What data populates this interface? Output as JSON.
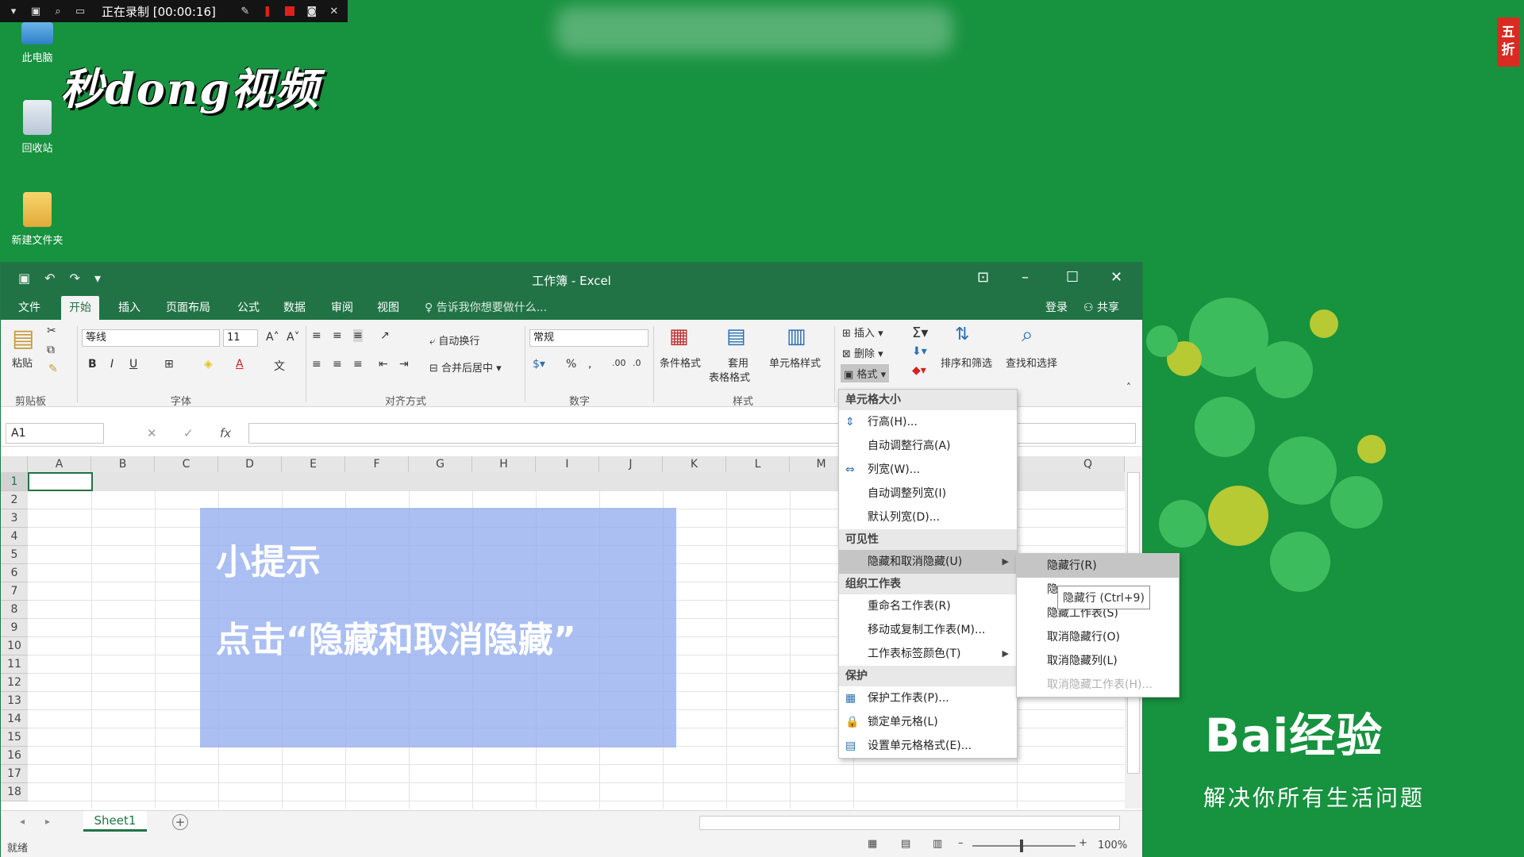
{
  "recorder": {
    "text": "正在录制 [00:00:16]"
  },
  "desktop": {
    "icons": [
      {
        "label": "此电脑"
      },
      {
        "label": "回收站"
      },
      {
        "label": "新建文件夹"
      }
    ],
    "logo": "秒dong视频",
    "promo": "五折"
  },
  "baidu": {
    "logo": "Bai经验",
    "slogan": "解决你所有生活问题"
  },
  "excel": {
    "title": "工作簿 - Excel",
    "tabs": [
      "文件",
      "开始",
      "插入",
      "页面布局",
      "公式",
      "数据",
      "审阅",
      "视图"
    ],
    "tell_me": "告诉我你想要做什么...",
    "login": "登录",
    "share": "共享",
    "ribbon": {
      "paste": "粘贴",
      "font_name": "等线",
      "font_size": "11",
      "wrap_text": "自动换行",
      "merge_center": "合并后居中",
      "number_format": "常规",
      "cond_format": "条件格式",
      "table_format_1": "套用",
      "table_format_2": "表格格式",
      "cell_style": "单元格样式",
      "insert": "插入",
      "delete": "删除",
      "format": "格式",
      "sort_filter": "排序和筛选",
      "find_select": "查找和选择",
      "groups": {
        "clipboard": "剪贴板",
        "font": "字体",
        "alignment": "对齐方式",
        "number": "数字",
        "styles": "样式"
      }
    },
    "name_box": "A1",
    "columns": [
      "A",
      "B",
      "C",
      "D",
      "E",
      "F",
      "G",
      "H",
      "I",
      "J",
      "K",
      "L",
      "M",
      "Q"
    ],
    "rows": [
      "1",
      "2",
      "3",
      "4",
      "5",
      "6",
      "7",
      "8",
      "9",
      "10",
      "11",
      "12",
      "13",
      "14",
      "15",
      "16",
      "17",
      "18"
    ],
    "sheet_tab": "Sheet1",
    "status": "就绪",
    "zoom": "100%"
  },
  "tip": {
    "title": "小提示",
    "body": "点击“隐藏和取消隐藏”"
  },
  "format_menu": {
    "sections": [
      {
        "header": "单元格大小",
        "items": [
          "行高(H)...",
          "自动调整行高(A)",
          "列宽(W)...",
          "自动调整列宽(I)",
          "默认列宽(D)..."
        ]
      },
      {
        "header": "可见性",
        "items": [
          "隐藏和取消隐藏(U)"
        ]
      },
      {
        "header": "组织工作表",
        "items": [
          "重命名工作表(R)",
          "移动或复制工作表(M)...",
          "工作表标签颜色(T)"
        ]
      },
      {
        "header": "保护",
        "items": [
          "保护工作表(P)...",
          "锁定单元格(L)",
          "设置单元格格式(E)..."
        ]
      }
    ]
  },
  "submenu": {
    "items": [
      "隐藏行(R)",
      "隐",
      "隐藏工作表(S)",
      "取消隐藏行(O)",
      "取消隐藏列(L)",
      "取消隐藏工作表(H)..."
    ]
  },
  "tooltip": "隐藏行 (Ctrl+9)"
}
